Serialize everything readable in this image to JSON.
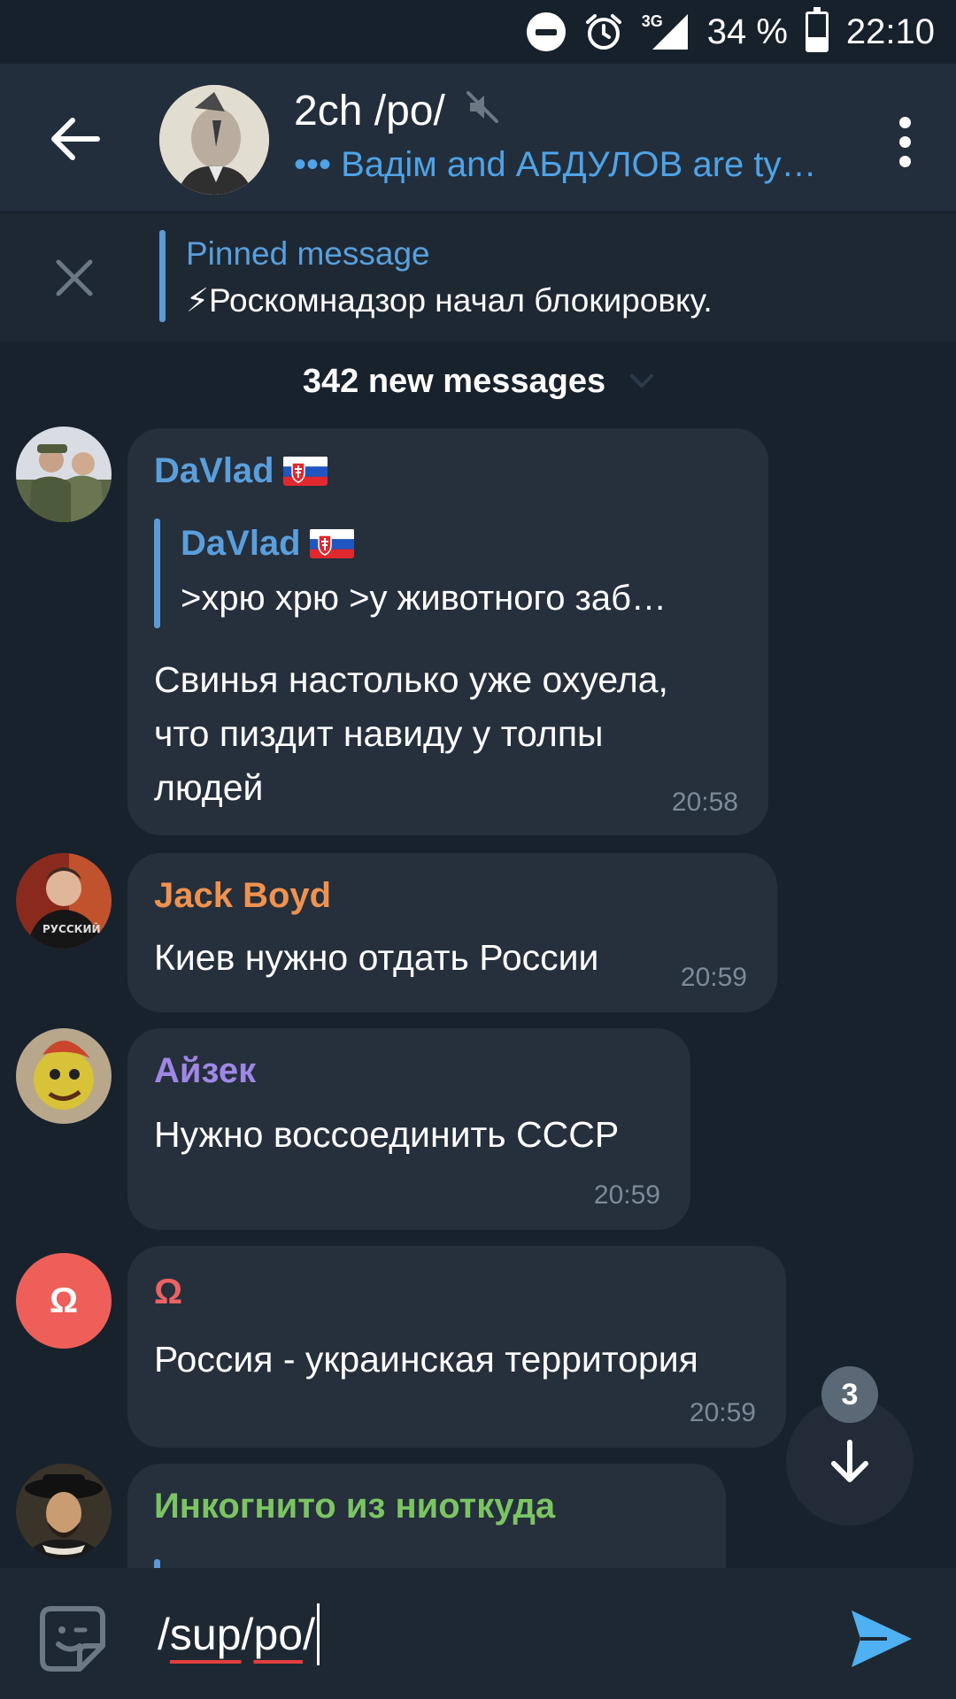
{
  "status_bar": {
    "network": "3G",
    "battery": "34 %",
    "battery_level": 0.34,
    "time": "22:10"
  },
  "header": {
    "title": "2ch /po/",
    "typing_status": "••• Вадім and АБДУЛОВ are ty…",
    "muted_icon": "muted-speaker-icon"
  },
  "pinned": {
    "label": "Pinned message",
    "text": "⚡Роскомнадзор начал блокировку."
  },
  "divider": {
    "label": "342 new messages"
  },
  "messages": [
    {
      "sender": "DaVlad",
      "sender_color": "#5a9fdc",
      "reply_sender": "DaVlad",
      "reply_text": ">хрю хрю >у животного заб…",
      "lines": [
        "Свинья настолько уже охуела,",
        "что пиздит навиду у толпы",
        "людей"
      ],
      "time": "20:58"
    },
    {
      "sender": "Jack Boyd",
      "sender_color": "#f0924f",
      "lines": [
        "Киев нужно отдать России"
      ],
      "time": "20:59"
    },
    {
      "sender": "Айзек",
      "sender_color": "#9f87e6",
      "lines": [
        "Нужно воссоединить СССР"
      ],
      "time": "20:59"
    },
    {
      "sender": "Ω",
      "sender_color": "#ec6262",
      "avatar_letter": "Ω",
      "avatar_color": "#ef5f5a",
      "lines": [
        "Россия - украинская территория"
      ],
      "time": "20:59"
    },
    {
      "sender": "Инкогнито из ниоткуда",
      "sender_color": "#7bc462"
    }
  ],
  "scroll_fab": {
    "unread_count": "3",
    "icon": "arrow-down-icon"
  },
  "composer": {
    "text_part1": "/",
    "text_part2": "sup",
    "text_part3": " /",
    "text_part4": "po",
    "text_part5": "/",
    "emoji_icon": "sticker-icon",
    "send_icon": "send-icon"
  }
}
